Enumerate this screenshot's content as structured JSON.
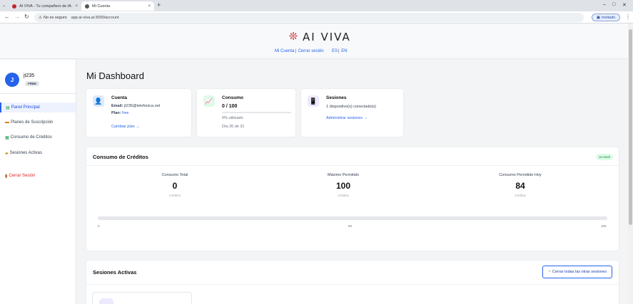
{
  "browser": {
    "tabs": [
      {
        "title": "AI VIVA - Tu compañero de IA ...",
        "active": false,
        "favicon_color": "#c0242b"
      },
      {
        "title": "Mi Cuenta",
        "active": true,
        "favicon_color": "#555555"
      }
    ],
    "security_label": "No es seguro",
    "url": "app.ai-viva.ai:3000/account",
    "profile_label": "Invitado"
  },
  "header": {
    "brand": "AI VIVA",
    "links": [
      "Mi Cuenta",
      "Cerrar sesión",
      "ES",
      "EN"
    ]
  },
  "user": {
    "initial": "J",
    "name": "jt235",
    "plan_badge": "FREE"
  },
  "sidebar": {
    "items": [
      {
        "icon": "dashboard-icon",
        "label": "Panel Principal",
        "active": true
      },
      {
        "icon": "card-icon",
        "label": "Planes de Suscripción",
        "active": false
      },
      {
        "icon": "chart-icon",
        "label": "Consumo de Créditos",
        "active": false
      },
      {
        "icon": "lock-icon",
        "label": "Sesiones Activas",
        "active": false
      }
    ],
    "logout": "Cerrar Sesión"
  },
  "main": {
    "title": "Mi Dashboard",
    "account_card": {
      "title": "Cuenta",
      "email_label": "Email:",
      "email": "jt235@telefonica.net",
      "plan_label": "Plan:",
      "plan": "free",
      "action": "Cambiar plan →"
    },
    "usage_card": {
      "title": "Consumo",
      "value": "0 / 100",
      "percent_text": "0% utilizado",
      "day_text": "Día 26 de 31",
      "progress": 0
    },
    "sessions_card": {
      "title": "Sesiones",
      "text": "1 dispositivo(s) conectado(s)",
      "action": "Administrar sesiones →"
    },
    "credits": {
      "title": "Consumo de Créditos",
      "status": "on track",
      "stats": [
        {
          "label": "Consumo Total",
          "value": "0",
          "unit": "créditos"
        },
        {
          "label": "Máximo Permitido",
          "value": "100",
          "unit": "créditos"
        },
        {
          "label": "Consumo Permitido Hoy",
          "value": "84",
          "unit": "créditos"
        }
      ],
      "progress": 0,
      "scale": [
        "0",
        "50",
        "100"
      ]
    },
    "active_sessions": {
      "title": "Sesiones Activas",
      "close_all": "Cerrar todas las otras sesiones"
    }
  }
}
